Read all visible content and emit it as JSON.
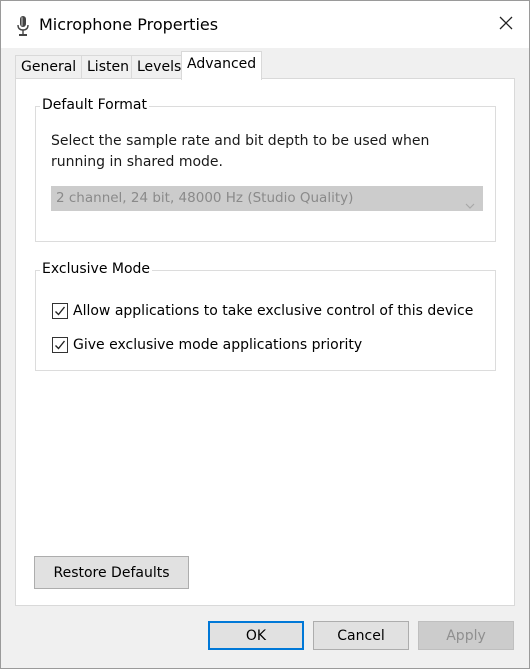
{
  "window": {
    "title": "Microphone Properties",
    "title_icon": "microphone-icon",
    "close_icon": "close-icon"
  },
  "tabs": [
    {
      "label": "General",
      "active": false
    },
    {
      "label": "Listen",
      "active": false
    },
    {
      "label": "Levels",
      "active": false
    },
    {
      "label": "Advanced",
      "active": true
    }
  ],
  "default_format": {
    "label": "Default Format",
    "description": "Select the sample rate and bit depth to be used when running in shared mode.",
    "selected_format": "2 channel, 24 bit, 48000 Hz (Studio Quality)",
    "enabled": false
  },
  "exclusive_mode": {
    "label": "Exclusive Mode",
    "options": [
      {
        "label": "Allow applications to take exclusive control of this device",
        "checked": true
      },
      {
        "label": "Give exclusive mode applications priority",
        "checked": true
      }
    ]
  },
  "buttons": {
    "restore_defaults": "Restore Defaults",
    "ok": "OK",
    "cancel": "Cancel",
    "apply": "Apply"
  },
  "colors": {
    "accent": "#0078d7",
    "disabled_bg": "#cccccc"
  }
}
